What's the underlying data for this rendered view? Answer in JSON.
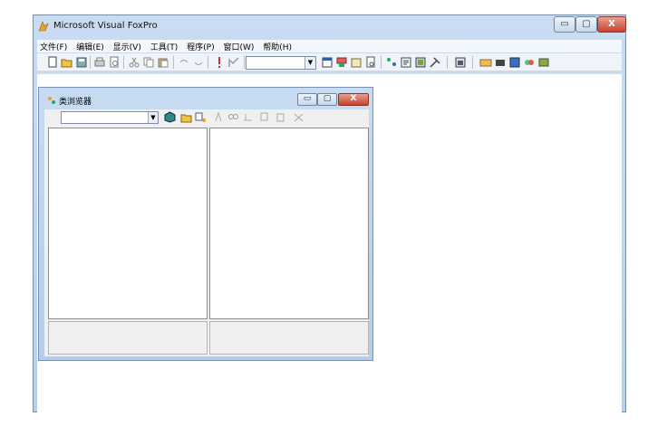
{
  "main_window": {
    "title": "Microsoft Visual FoxPro",
    "controls": {
      "minimize": "▭",
      "maximize": "▢",
      "close": "X"
    }
  },
  "menu": [
    "文件(F)",
    "编辑(E)",
    "显示(V)",
    "工具(T)",
    "程序(P)",
    "窗口(W)",
    "帮助(H)"
  ],
  "toolbar": {
    "icons": [
      "new-icon",
      "open-icon",
      "save-icon",
      "print-icon",
      "print-preview-icon",
      "cut-icon",
      "copy-icon",
      "paste-icon",
      "undo-icon",
      "redo-icon",
      "run-icon",
      "modify-icon",
      "database-dropdown",
      "command-window-icon",
      "view-window-icon",
      "form-wizard-icon",
      "report-wizard-icon",
      "properties-icon",
      "code-icon",
      "form-designer-icon",
      "toolbox-icon",
      "class-browser-icon",
      "component-gallery-icon",
      "coverage-icon",
      "task-list-icon",
      "document-view-icon"
    ],
    "combo_value": ""
  },
  "class_browser": {
    "title": "类浏览器",
    "controls": {
      "minimize": "▭",
      "maximize": "▢",
      "close": "X"
    },
    "combo_value": ""
  },
  "colors": {
    "title_gradient": "#c9dcf2",
    "close_red": "#c7412b"
  }
}
